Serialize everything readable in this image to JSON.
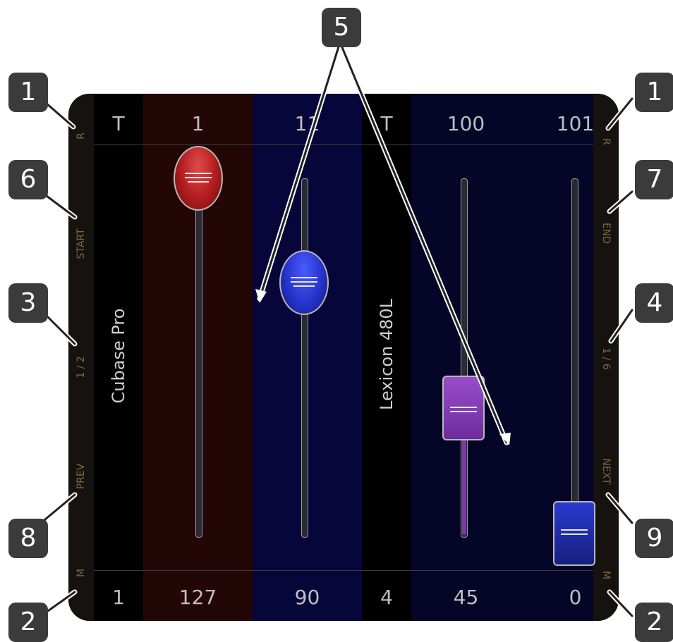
{
  "left_strip": {
    "top": "R",
    "start": "START",
    "page": "1 / 2",
    "prev": "PREV",
    "bottom": "M"
  },
  "right_strip": {
    "top": "R",
    "end": "END",
    "page": "1 / 6",
    "next": "NEXT",
    "bottom": "M"
  },
  "columns": [
    {
      "kind": "track",
      "top": "T",
      "name": "Cubase Pro",
      "bottom": "1"
    },
    {
      "kind": "fader",
      "top": "1",
      "bottom": "127",
      "value": 127,
      "color": "#c0282a",
      "shape": "round"
    },
    {
      "kind": "fader",
      "top": "11",
      "bottom": "90",
      "value": 90,
      "color": "#2a36d8",
      "shape": "round"
    },
    {
      "kind": "track",
      "top": "T",
      "name": "Lexicon 480L",
      "bottom": "4"
    },
    {
      "kind": "fader",
      "top": "100",
      "bottom": "45",
      "value": 45,
      "color": "#7e3ab0",
      "shape": "rect"
    },
    {
      "kind": "fader",
      "top": "101",
      "bottom": "0",
      "value": 0,
      "color": "#1c2aa0",
      "shape": "rect"
    }
  ],
  "callouts": [
    "1",
    "1",
    "6",
    "7",
    "3",
    "4",
    "5",
    "8",
    "9",
    "2",
    "2"
  ],
  "colors": {
    "panel_bg": "#0a0a0e",
    "strip_bg": "#15120f",
    "strip_text": "#7c6a3d",
    "fader_bg_red": "#230606",
    "fader_bg_blue": "#06063a",
    "fader_bg_dark_blue": "#050528"
  }
}
